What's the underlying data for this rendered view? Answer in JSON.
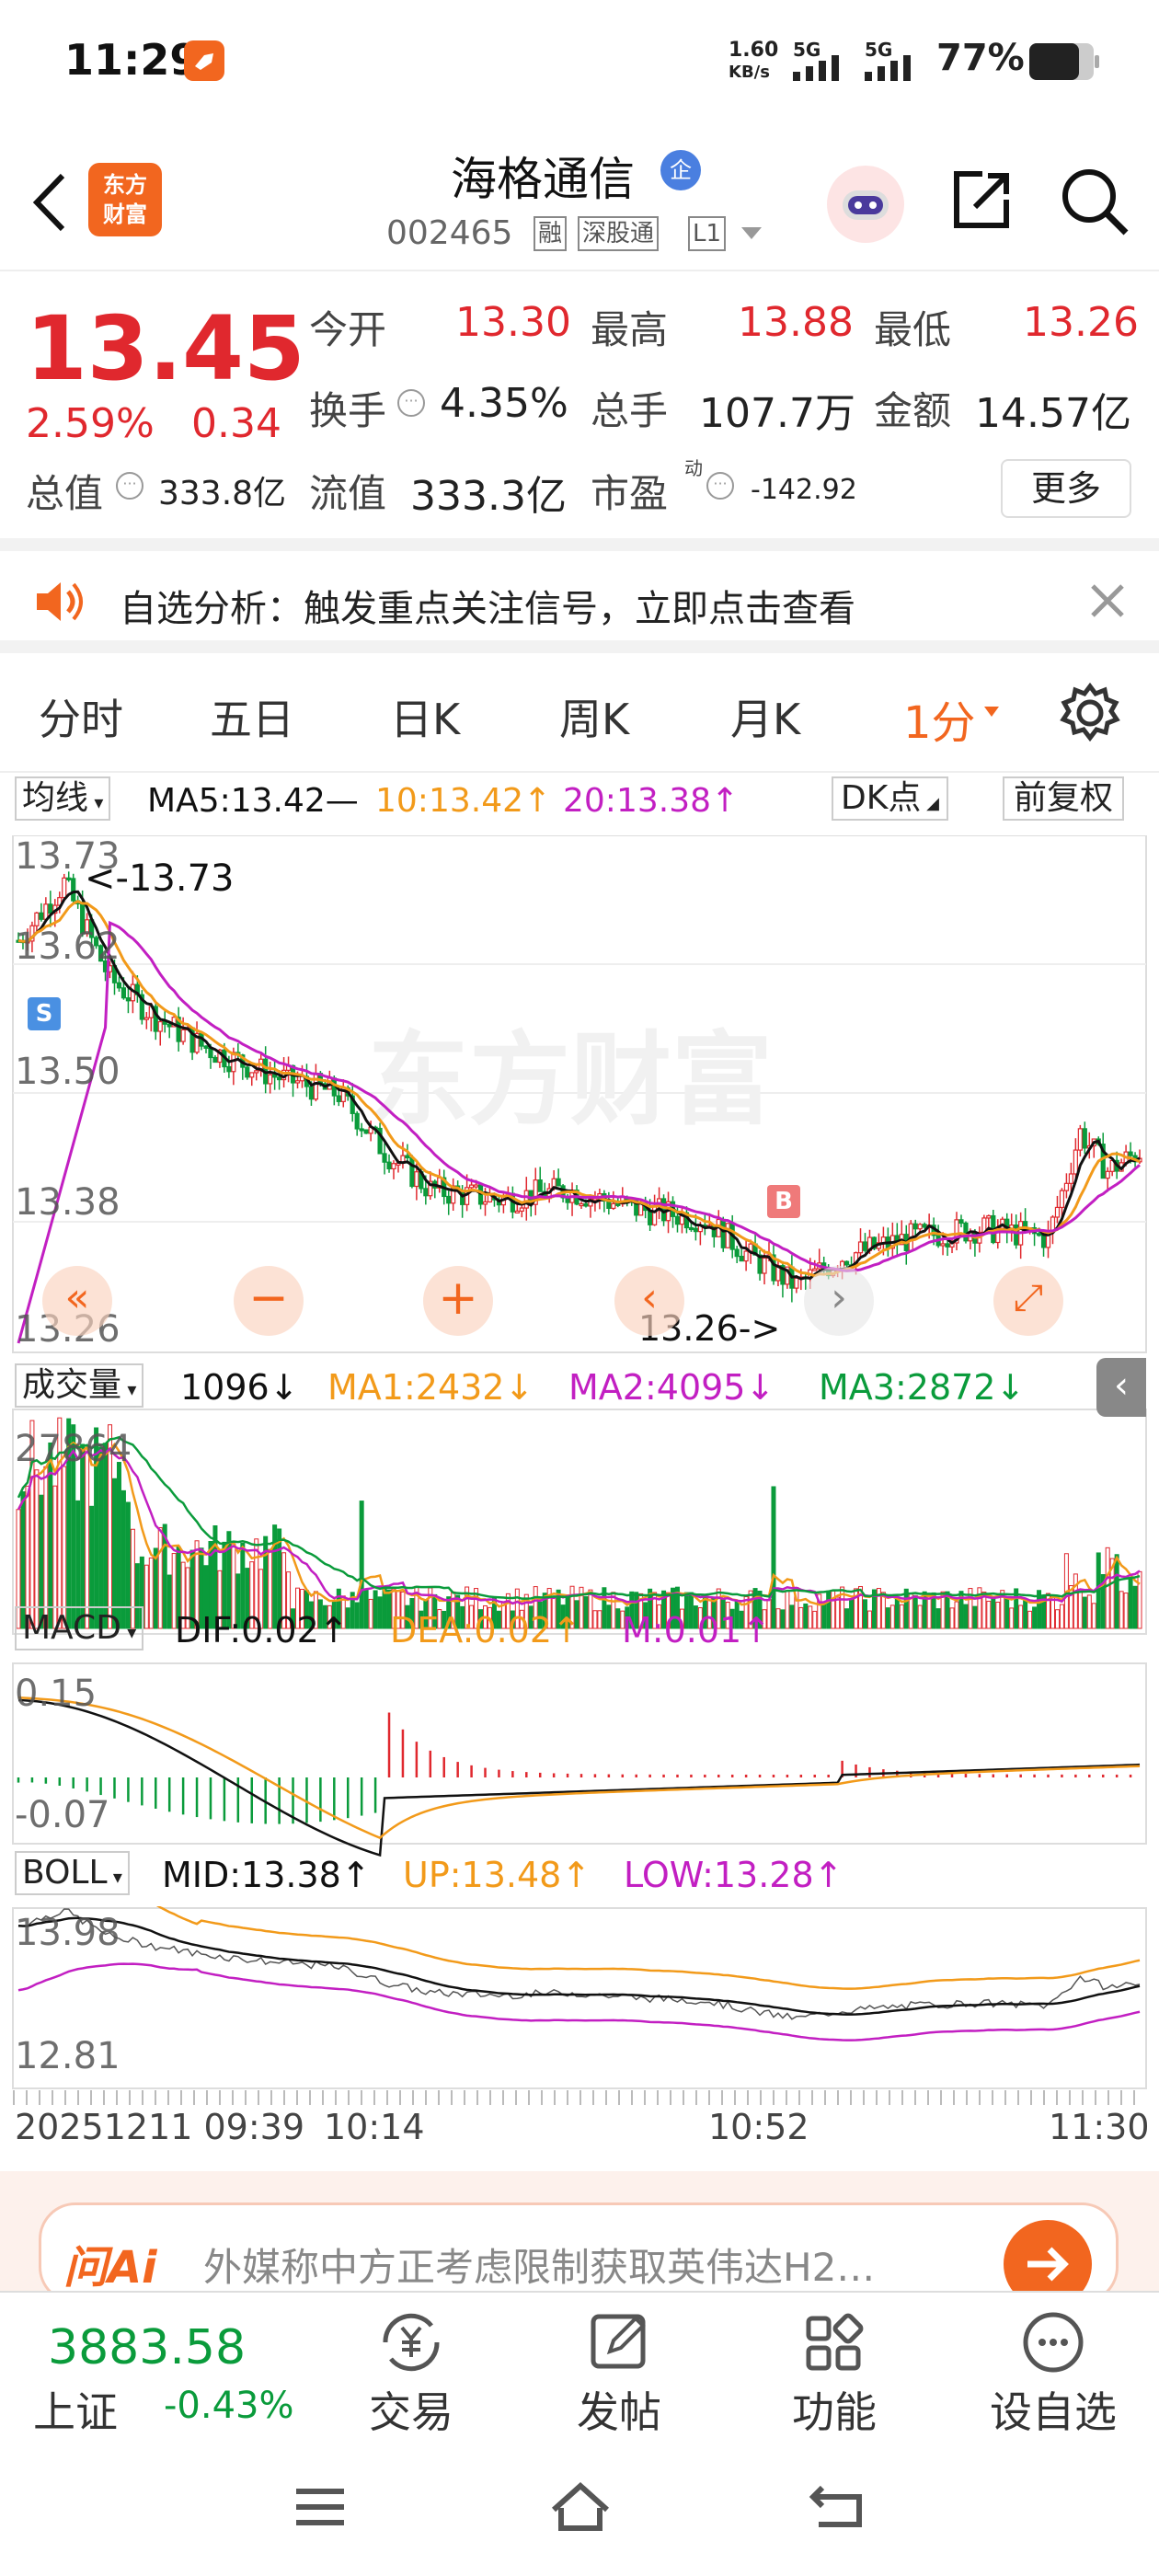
{
  "status_bar": {
    "time": "11:29",
    "net_speed_value": "1.60",
    "net_speed_unit": "KB/s",
    "signal1": "5G",
    "signal2": "5G",
    "battery": "77%"
  },
  "header": {
    "stock_name": "海格通信",
    "enterprise_badge": "企",
    "stock_code": "002465",
    "badge_margin": "融",
    "badge_connect": "深股通",
    "badge_level": "L1",
    "logo_text": [
      "东方",
      "财富"
    ]
  },
  "quote": {
    "price": "13.45",
    "change_pct": "2.59%",
    "change": "0.34",
    "open_label": "今开",
    "open": "13.30",
    "high_label": "最高",
    "high": "13.88",
    "low_label": "最低",
    "low": "13.26",
    "turnover_label": "换手",
    "turnover": "4.35%",
    "volume_label": "总手",
    "volume": "107.7万",
    "amount_label": "金额",
    "amount": "14.57亿",
    "mktcap_label": "总值",
    "mktcap": "333.8亿",
    "float_label": "流值",
    "float_cap": "333.3亿",
    "pe_label": "市盈",
    "pe_sup": "动",
    "pe": "-142.92",
    "more_button": "更多"
  },
  "alert": {
    "text": "自选分析：触发重点关注信号，立即点击查看"
  },
  "tabs": [
    "分时",
    "五日",
    "日K",
    "周K",
    "月K",
    "1分"
  ],
  "chart": {
    "ma_selector": "均线",
    "ma5": "MA5:13.42—",
    "ma10": "10:13.42",
    "ma20": "20:13.38",
    "dk_button": "DK点",
    "adjust_button": "前复权",
    "price_ticks": [
      "13.73",
      "13.62",
      "13.50",
      "13.38",
      "13.26"
    ],
    "high_note": "<-13.73",
    "low_note": "13.26->",
    "sell_marker": "S",
    "buy_marker": "B",
    "watermark": "东方财富",
    "vol_selector": "成交量",
    "vol_value": "1096",
    "vol_ma1": "MA1:2432",
    "vol_ma2": "MA2:4095",
    "vol_ma3": "MA3:2872",
    "vol_tick": "27864",
    "macd_selector": "MACD",
    "dif": "DIF:0.02",
    "dea": "DEA:0.02",
    "m": "M:0.01",
    "macd_hi": "0.15",
    "macd_lo": "-0.07",
    "boll_selector": "BOLL",
    "mid": "MID:13.38",
    "up": "UP:13.48",
    "low": "LOW:13.28",
    "boll_hi": "13.98",
    "boll_lo": "12.81",
    "time_start": "20251211 09:39",
    "time_2": "10:14",
    "time_3": "10:52",
    "time_end": "11:30"
  },
  "ai_banner": {
    "logo": "问Ai",
    "text": "外媒称中方正考虑限制获取英伟达H2…"
  },
  "bottom_nav": {
    "index_value": "3883.58",
    "index_name": "上证",
    "index_change": "-0.43%",
    "items": [
      "交易",
      "发帖",
      "功能",
      "设自选"
    ]
  },
  "colors": {
    "up": "#e0282e",
    "down": "#0a9b3b",
    "accent": "#f2661f",
    "ma10": "#f29a1a",
    "ma20": "#c21fc2"
  }
}
